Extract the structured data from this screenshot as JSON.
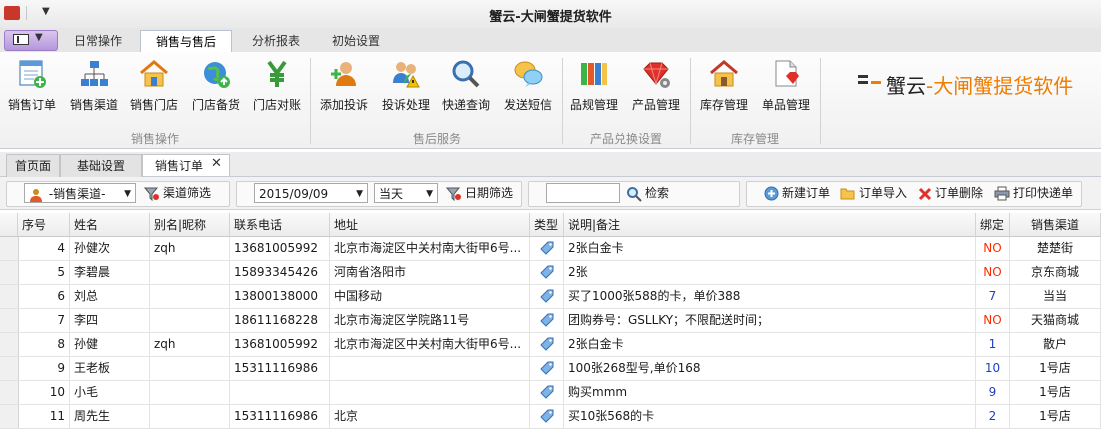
{
  "window": {
    "title": "蟹云-大闸蟹提货软件"
  },
  "quick_access": {
    "arrow": "▼"
  },
  "ribbon_tabs": [
    "日常操作",
    "销售与售后",
    "分析报表",
    "初始设置"
  ],
  "ribbon": {
    "groups": [
      {
        "label": "销售操作",
        "buttons": [
          "销售订单",
          "销售渠道",
          "销售门店",
          "门店备货",
          "门店对账"
        ]
      },
      {
        "label": "售后服务",
        "buttons": [
          "添加投诉",
          "投诉处理",
          "快递查询",
          "发送短信"
        ]
      },
      {
        "label": "产品兑换设置",
        "buttons": [
          "品规管理",
          "产品管理"
        ]
      },
      {
        "label": "库存管理",
        "buttons": [
          "库存管理",
          "单品管理"
        ]
      }
    ],
    "brand": {
      "part1": "蟹云",
      "part2": "-大闸蟹提货软件"
    }
  },
  "doc_tabs": [
    "首页面",
    "基础设置",
    "销售订单"
  ],
  "doc_tab_close": "✕",
  "toolbar": {
    "channel_select": "-销售渠道-",
    "channel_filter": "渠道筛选",
    "date_value": "2015/09/09",
    "period_select": "当天",
    "date_filter": "日期筛选",
    "search_value": "",
    "search_button": "检索",
    "new_order": "新建订单",
    "import_order": "订单导入",
    "delete_order": "订单删除",
    "print_express": "打印快递单"
  },
  "table": {
    "headers": [
      "序号",
      "姓名",
      "别名|昵称",
      "联系电话",
      "地址",
      "类型",
      "说明|备注",
      "绑定",
      "销售渠道"
    ],
    "rows": [
      {
        "no": "4",
        "name": "孙健次",
        "alias": "zqh",
        "phone": "13681005992",
        "address": "北京市海淀区中关村南大街甲6号...",
        "note": "2张白金卡",
        "bind": "NO",
        "channel": "楚楚街"
      },
      {
        "no": "5",
        "name": "李碧晨",
        "alias": "",
        "phone": "15893345426",
        "address": "河南省洛阳市",
        "note": "2张",
        "bind": "NO",
        "channel": "京东商城"
      },
      {
        "no": "6",
        "name": "刘总",
        "alias": "",
        "phone": "13800138000",
        "address": "中国移动",
        "note": "买了1000张588的卡，单价388",
        "bind": "7",
        "channel": "当当"
      },
      {
        "no": "7",
        "name": "李四",
        "alias": "",
        "phone": "18611168228",
        "address": "北京市海淀区学院路11号",
        "note": "团购券号：GSLLKY；不限配送时间；",
        "bind": "NO",
        "channel": "天猫商城"
      },
      {
        "no": "8",
        "name": "孙健",
        "alias": "zqh",
        "phone": "13681005992",
        "address": "北京市海淀区中关村南大街甲6号...",
        "note": "2张白金卡",
        "bind": "1",
        "channel": "散户"
      },
      {
        "no": "9",
        "name": "王老板",
        "alias": "",
        "phone": "15311116986",
        "address": "",
        "note": "100张268型号,单价168",
        "bind": "10",
        "channel": "1号店"
      },
      {
        "no": "10",
        "name": "小毛",
        "alias": "",
        "phone": "",
        "address": "",
        "note": "购买mmm",
        "bind": "9",
        "channel": "1号店"
      },
      {
        "no": "11",
        "name": "周先生",
        "alias": "",
        "phone": "15311116986",
        "address": "北京",
        "note": "买10张568的卡",
        "bind": "2",
        "channel": "1号店"
      }
    ]
  },
  "colors": {
    "no_flag": "#ff2b00",
    "bind_number": "#1f3fbf",
    "brand_orange": "#f07c00",
    "app_menu": "#b596da"
  }
}
